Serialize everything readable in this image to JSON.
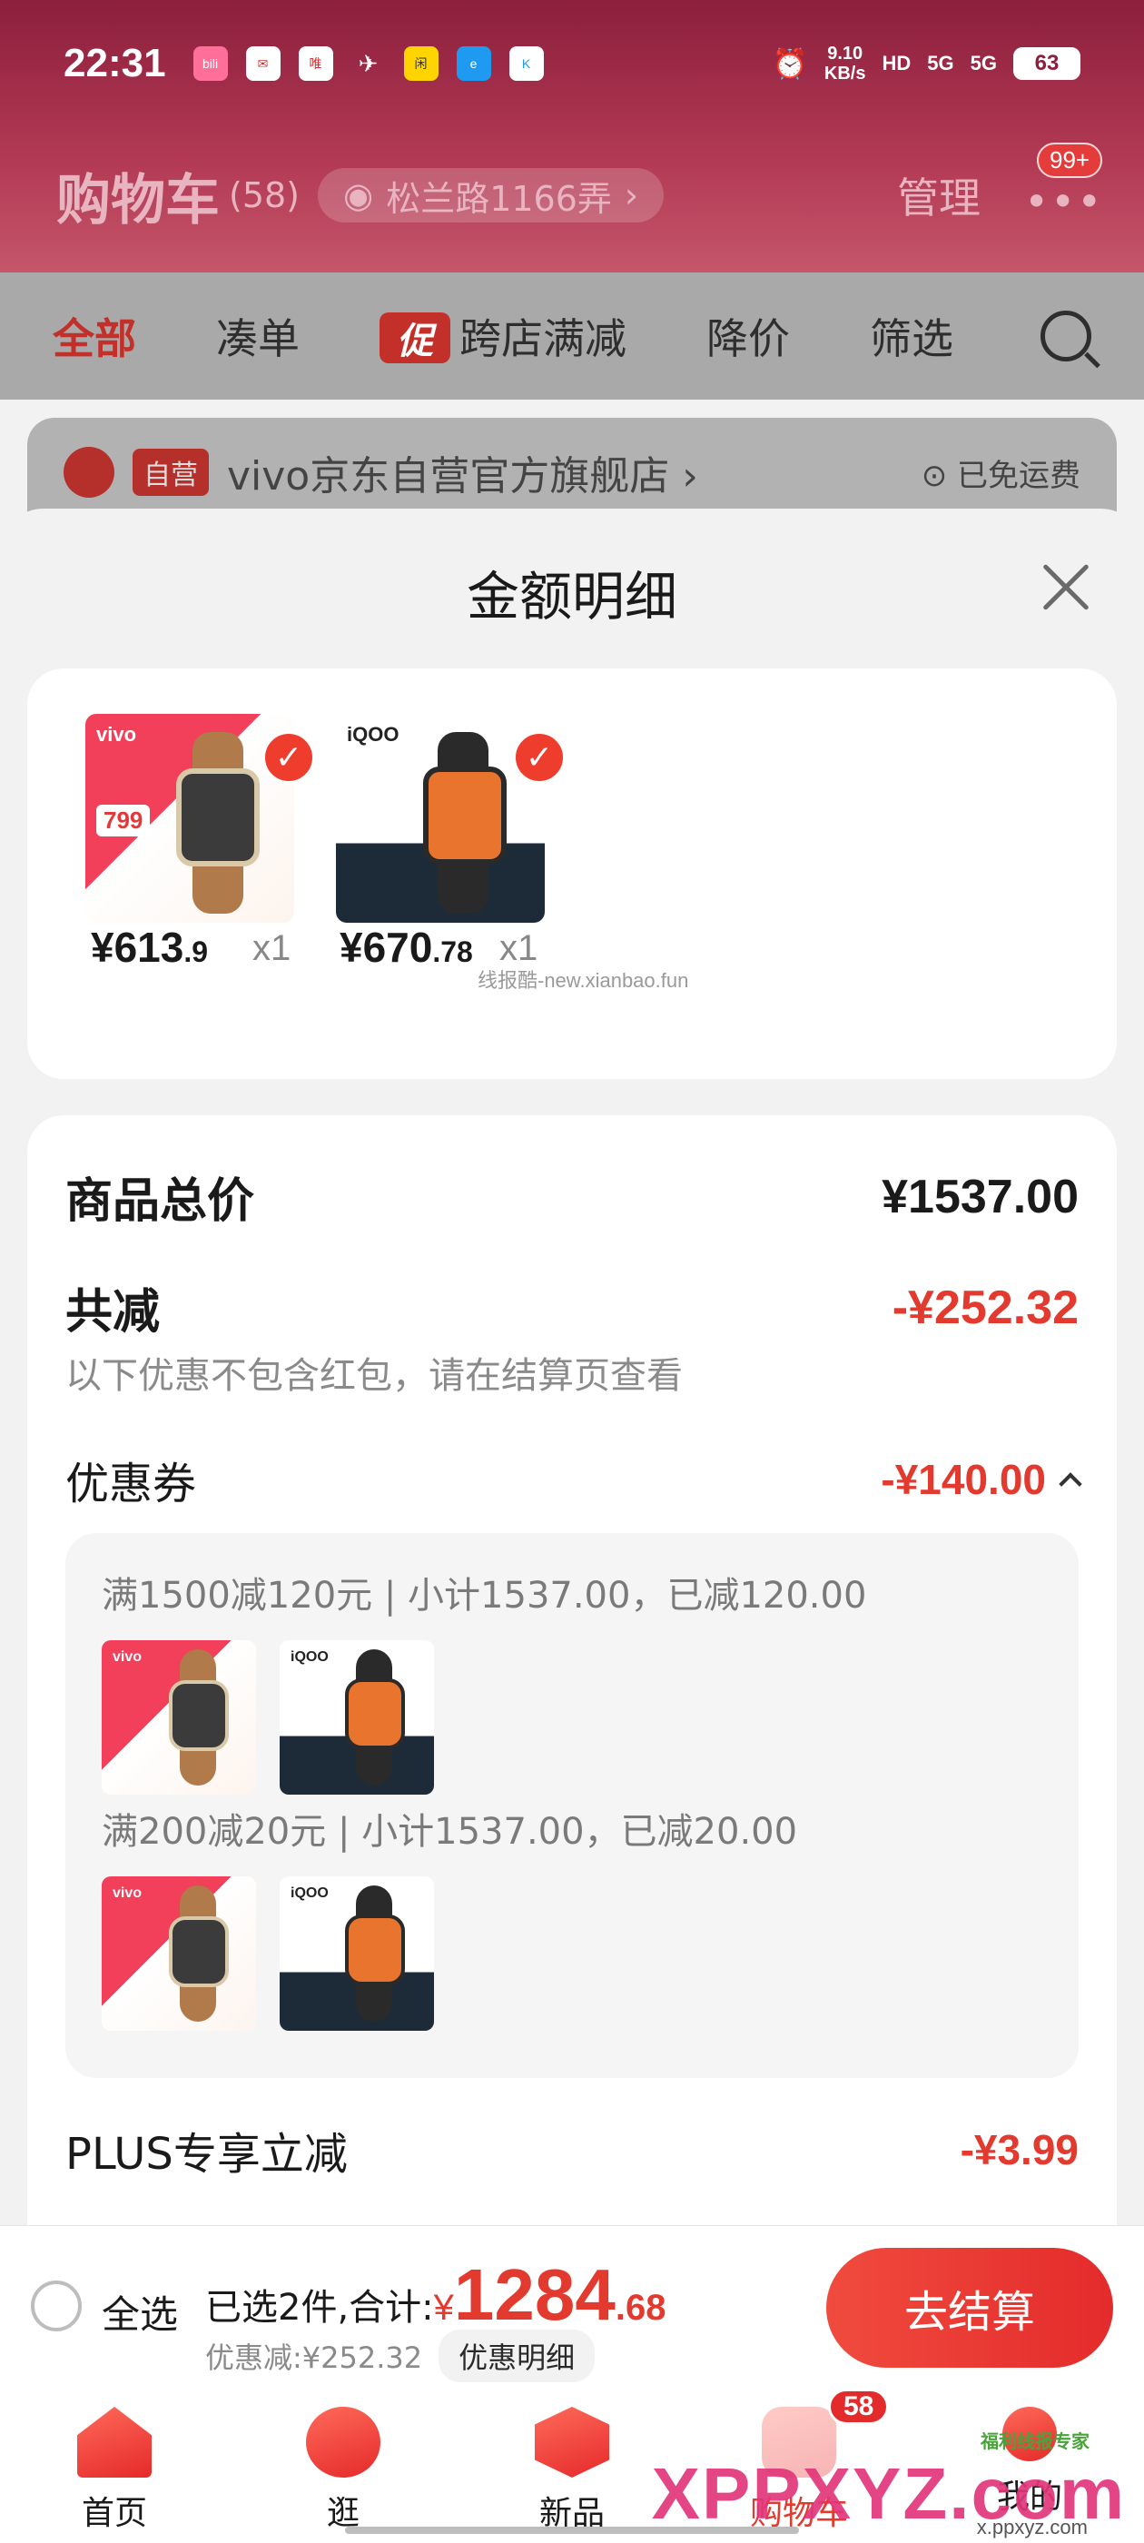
{
  "status_bar": {
    "time": "22:31",
    "net_speed_value": "9.10",
    "net_speed_unit": "KB/s",
    "hd": "HD",
    "signal1": "5G",
    "signal2": "5G",
    "battery": "63",
    "app_icons": [
      "bilibili",
      "mail",
      "唯",
      "bird",
      "闲鱼",
      "e",
      "K"
    ]
  },
  "header": {
    "title": "购物车",
    "count": "(58)",
    "address": "松兰路1166弄",
    "manage": "管理",
    "badge": "99+"
  },
  "filters": [
    {
      "label": "全部",
      "active": true
    },
    {
      "label": "凑单",
      "active": false
    },
    {
      "label": "跨店满减",
      "active": false,
      "tag": "促"
    },
    {
      "label": "降价",
      "active": false
    },
    {
      "label": "筛选",
      "active": false
    }
  ],
  "store_peek": {
    "tag": "自营",
    "name": "vivo京东自营官方旗舰店 ›",
    "right": "⊙ 已免运费"
  },
  "sheet": {
    "title": "金额明细",
    "watermark": "线报酷-new.xianbao.fun",
    "items": [
      {
        "brand": "vivo",
        "thumb_price": "799",
        "price_int": "¥613",
        "price_dec": ".9",
        "qty": "x1"
      },
      {
        "brand": "iQOO",
        "price_int": "¥670",
        "price_dec": ".78",
        "qty": "x1"
      }
    ],
    "total_label": "商品总价",
    "total_value": "¥1537.00",
    "reduce_label": "共减",
    "reduce_value": "-¥252.32",
    "reduce_note": "以下优惠不包含红包，请在结算页查看",
    "coupon_label": "优惠券",
    "coupon_value": "-¥140.00",
    "coupons": [
      {
        "text": "满1500减120元 | 小计1537.00，已减120.00"
      },
      {
        "text": "满200减20元 | 小计1537.00，已减20.00"
      }
    ],
    "plus_label": "PLUS专享立减",
    "plus_value": "-¥3.99"
  },
  "checkout": {
    "select_all": "全选",
    "selected_text": "已选2件,合计:",
    "currency": "¥",
    "total_int": "1284",
    "total_dec": ".68",
    "discount_text": "优惠减:¥252.32",
    "detail_button": "优惠明细",
    "pay_button": "去结算"
  },
  "tabbar": {
    "tabs": [
      {
        "label": "首页",
        "icon": "home-icon"
      },
      {
        "label": "逛",
        "icon": "guang-icon"
      },
      {
        "label": "新品",
        "icon": "new-icon"
      },
      {
        "label": "购物车",
        "icon": "cart-icon",
        "badge": "58",
        "active": true
      },
      {
        "label": "我的",
        "icon": "profile-icon"
      }
    ]
  },
  "overlay": {
    "logo": "XPPXYZ.com",
    "sub": "福利线报专家",
    "url": "x.ppxyz.com"
  },
  "colors": {
    "accent": "#e23a2e",
    "header_bg": "#8c1f3c",
    "button_gradient": "#f04b3e"
  }
}
